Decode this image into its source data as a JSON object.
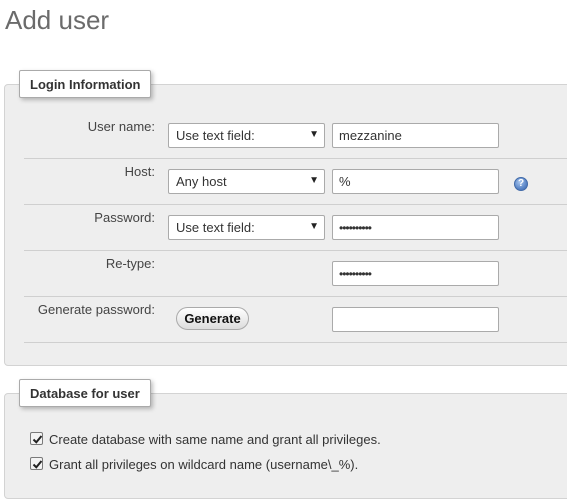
{
  "page": {
    "title": "Add user"
  },
  "login": {
    "legend": "Login Information",
    "username": {
      "label": "User name:",
      "mode": "Use text field:",
      "value": "mezzanine"
    },
    "host": {
      "label": "Host:",
      "mode": "Any host",
      "value": "%"
    },
    "password": {
      "label": "Password:",
      "mode": "Use text field:",
      "value": "••••••••••"
    },
    "retype": {
      "label": "Re-type:",
      "value": "••••••••••"
    },
    "generate": {
      "label": "Generate password:",
      "button": "Generate",
      "value": ""
    },
    "help_icon": "help-question-icon"
  },
  "database": {
    "legend": "Database for user",
    "options": [
      {
        "label": "Create database with same name and grant all privileges.",
        "checked": true
      },
      {
        "label": "Grant all privileges on wildcard name (username\\_%).",
        "checked": true
      }
    ]
  }
}
